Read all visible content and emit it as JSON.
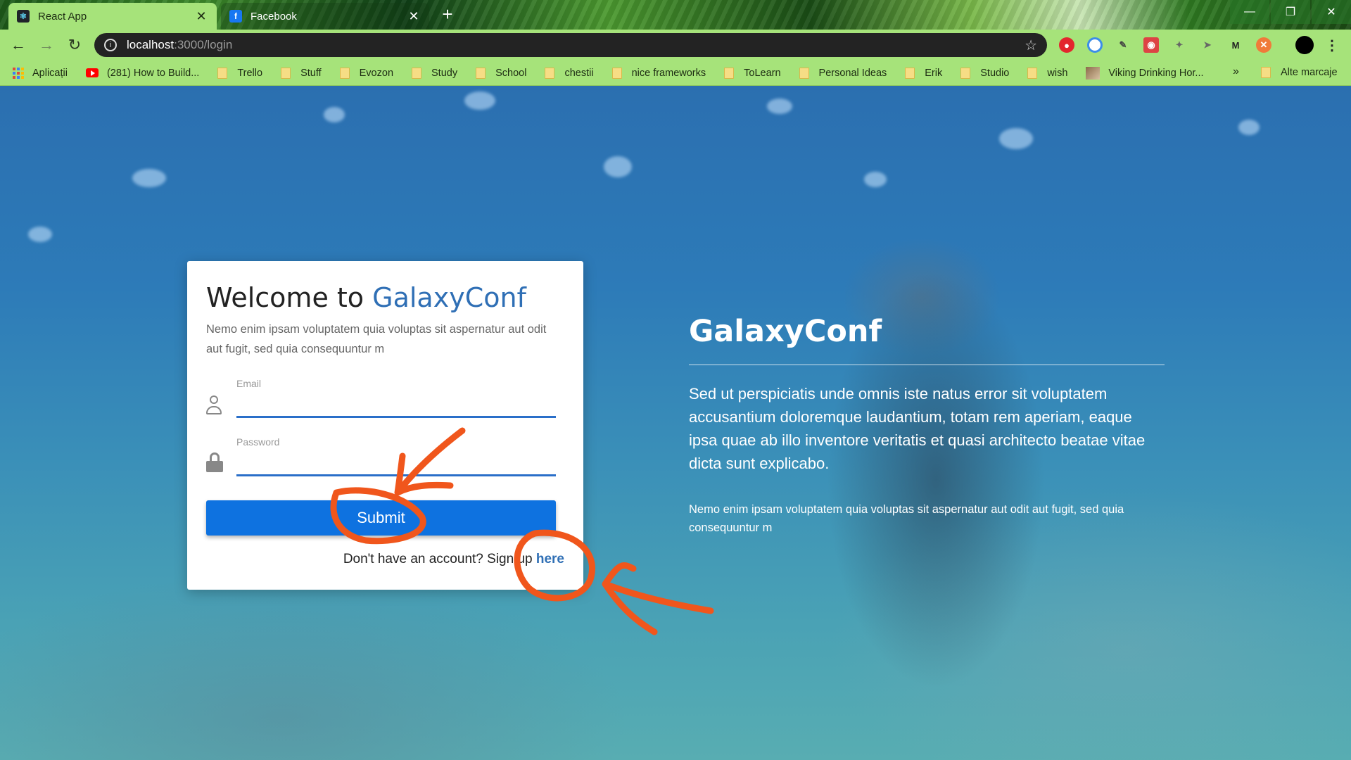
{
  "browser": {
    "tabs": [
      {
        "title": "React App",
        "favicon": "react-icon",
        "active": true
      },
      {
        "title": "Facebook",
        "favicon": "facebook-icon",
        "active": false
      }
    ],
    "url_host": "localhost",
    "url_path": ":3000/login",
    "bookmarks": [
      {
        "label": "Aplicații",
        "icon": "apps-icon"
      },
      {
        "label": "(281) How to Build...",
        "icon": "youtube-icon"
      },
      {
        "label": "Trello",
        "icon": "folder-icon"
      },
      {
        "label": "Stuff",
        "icon": "folder-icon"
      },
      {
        "label": "Evozon",
        "icon": "folder-icon"
      },
      {
        "label": "Study",
        "icon": "folder-icon"
      },
      {
        "label": "School",
        "icon": "folder-icon"
      },
      {
        "label": "chestii",
        "icon": "folder-icon"
      },
      {
        "label": "nice frameworks",
        "icon": "folder-icon"
      },
      {
        "label": "ToLearn",
        "icon": "folder-icon"
      },
      {
        "label": "Personal Ideas",
        "icon": "folder-icon"
      },
      {
        "label": "Erik",
        "icon": "folder-icon"
      },
      {
        "label": "Studio",
        "icon": "folder-icon"
      },
      {
        "label": "wish",
        "icon": "folder-icon"
      },
      {
        "label": "Viking Drinking Hor...",
        "icon": "thumbnail-icon"
      }
    ],
    "bookmarks_overflow": "»",
    "other_bookmarks": "Alte marcaje",
    "extension_labels": {
      "m": "M"
    }
  },
  "login": {
    "title_prefix": "Welcome to ",
    "title_brand": "GalaxyConf",
    "subtitle": "Nemo enim ipsam voluptatem quia voluptas sit aspernatur aut odit aut fugit, sed quia consequuntur m",
    "email_label": "Email",
    "email_value": "",
    "password_label": "Password",
    "password_value": "",
    "submit_label": "Submit",
    "signup_prefix": "Don't have an account? Sign up ",
    "signup_link": "here"
  },
  "hero": {
    "title": "GalaxyConf",
    "lead": "Sed ut perspiciatis unde omnis iste natus error sit voluptatem accusantium doloremque laudantium, totam rem aperiam, eaque ipsa quae ab illo inventore veritatis et quasi architecto beatae vitae dicta sunt explicabo.",
    "text": "Nemo enim ipsam voluptatem quia voluptas sit aspernatur aut odit aut fugit, sed quia consequuntur m"
  },
  "colors": {
    "brand": "#2f6fb5",
    "submit": "#0e72e0",
    "annotation": "#f0561c",
    "chrome": "#a6e37a"
  }
}
